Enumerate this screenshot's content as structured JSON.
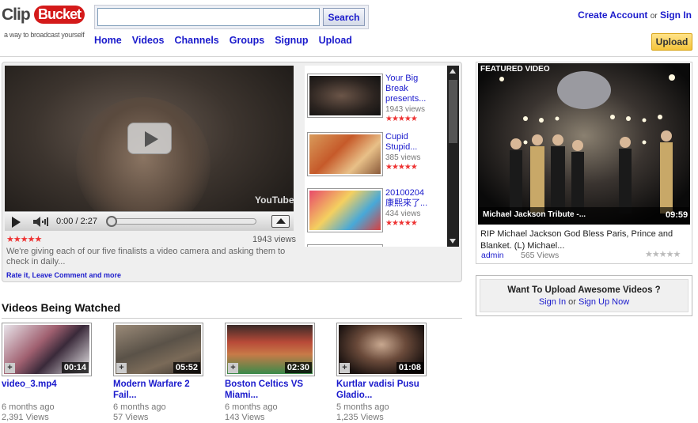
{
  "header": {
    "logo_clip": "Clip",
    "logo_bucket": "Bucket",
    "logo_tagline": "a way to broadcast yourself",
    "search_value": "",
    "search_button": "Search",
    "account": {
      "create": "Create Account",
      "or": "or",
      "signin": "Sign In"
    },
    "upload_button": "Upload",
    "nav": [
      "Home",
      "Videos",
      "Channels",
      "Groups",
      "Signup",
      "Upload"
    ]
  },
  "player": {
    "time": "0:00 / 2:27",
    "watermark": "YouTube",
    "stars": "★★★★★",
    "views": "1943 views",
    "description": "We're giving each of our five finalists a video camera and asking them to check in daily...",
    "links": "Rate it, Leave Comment and more"
  },
  "related": [
    {
      "title": "Your Big Break presents...",
      "views": "1943 views",
      "stars": "★★★★★"
    },
    {
      "title": "Cupid Stupid...",
      "views": "385 views",
      "stars": "★★★★★"
    },
    {
      "title": "20100204 康熙來了...",
      "views": "434 views",
      "stars": "★★★★★"
    }
  ],
  "being_watched": {
    "title": "Videos Being Watched",
    "videos": [
      {
        "title": "video_3.mp4",
        "duration": "00:14",
        "age": "6 months ago",
        "views": "2,391 Views"
      },
      {
        "title": "Modern Warfare 2 Fail...",
        "duration": "05:52",
        "age": "6 months ago",
        "views": "57 Views"
      },
      {
        "title": "Boston Celtics VS Miami...",
        "duration": "02:30",
        "age": "6 months ago",
        "views": "143 Views"
      },
      {
        "title": "Kurtlar vadisi Pusu Gladio...",
        "duration": "01:08",
        "age": "5 months ago",
        "views": "1,235 Views"
      }
    ]
  },
  "featured": {
    "label": "FEATURED VIDEO",
    "caption": "Michael Jackson Tribute -...",
    "duration": "09:59",
    "description": "RIP Michael Jackson God Bless Paris, Prince and Blanket. (L) Michael...",
    "user": "admin",
    "views": "565 Views",
    "stars": "★★★★★"
  },
  "upload_box": {
    "question": "Want To Upload Awesome Videos ?",
    "signin": "Sign In",
    "or": "or",
    "signup": "Sign Up Now"
  }
}
